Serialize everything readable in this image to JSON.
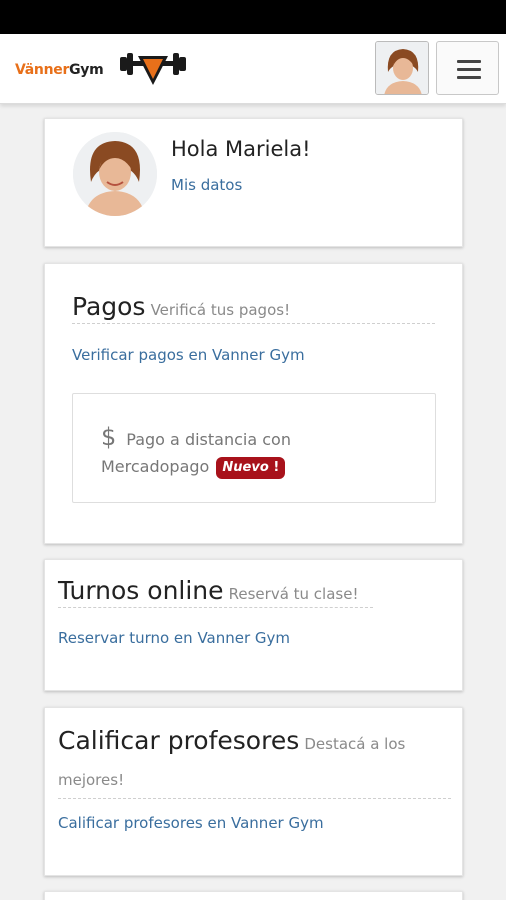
{
  "header": {
    "brand_part1": "Vänner",
    "brand_part2": "Gym",
    "logo_icon": "dumbbell-v-logo-icon",
    "avatar_icon": "user-avatar-icon",
    "menu_icon": "hamburger-menu-icon"
  },
  "profile": {
    "greeting": "Hola Mariela!",
    "link": "Mis datos"
  },
  "pagos": {
    "title": "Pagos",
    "subtitle": "Verificá tus pagos!",
    "link": "Verificar pagos en Vanner Gym",
    "box": {
      "icon_glyph": "$",
      "text": "Pago a distancia con Mercadopago",
      "badge": "Nuevo",
      "badge_icon": "!"
    }
  },
  "turnos": {
    "title": "Turnos online",
    "subtitle": "Reservá tu clase!",
    "link": "Reservar turno en Vanner Gym"
  },
  "calificar": {
    "title": "Calificar profesores",
    "subtitle": "Destacá a los mejores!",
    "link": "Calificar profesores en Vanner Gym"
  },
  "colors": {
    "brand_orange": "#e8701a",
    "link_blue": "#3a6e9e",
    "badge_red": "#a8121b"
  }
}
